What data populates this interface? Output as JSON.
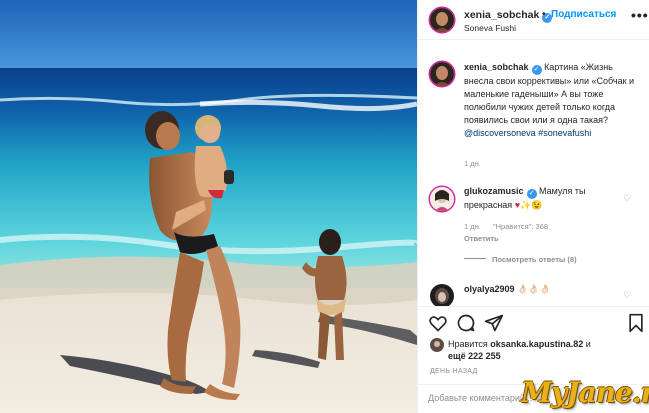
{
  "post": {
    "image_alt": "Beach photo: woman holding a child, another child standing in the surf",
    "author": "xenia_sobchak",
    "follow_separator": "•",
    "follow_label": "Подписаться",
    "location": "Soneva Fushi",
    "more_label": "•••"
  },
  "caption": {
    "author": "xenia_sobchak",
    "text": "Картина «Жизнь внесла свои коррективы» или «Собчак и маленькие гаденыши» А вы тоже полюбили чужих детей только когда появились свои или я одна такая?",
    "mention": "@discoversoneva",
    "hashtag": "#sonevafushi",
    "time": "1 дн."
  },
  "comments": [
    {
      "author": "glukozamusic",
      "text": "Мамуля ты прекрасная",
      "emoji": "♥︎✨😉",
      "time": "1 дн.",
      "likes": "\"Нравится\": 368",
      "reply_label": "Ответить",
      "view_replies": "Посмотреть ответы (8)"
    },
    {
      "author": "olyalya2909",
      "text": "👌🏻👌🏻👌🏻"
    }
  ],
  "likes": {
    "prefix": "Нравится",
    "user": "oksanka.kapustina.82",
    "and": "и",
    "others": "ещё 222 255"
  },
  "date": "ДЕНЬ НАЗАД",
  "add_comment": {
    "placeholder": "Добавьте комментарий..."
  },
  "watermark": "MyJane.ru",
  "icons": [
    "heart-icon",
    "comment-icon",
    "share-icon",
    "bookmark-icon",
    "verified-icon"
  ],
  "colors": {
    "link_blue": "#0095f6",
    "verified": "#3897f0",
    "sea": "#2fbfd1",
    "sand": "#efe6d6",
    "sky": "#2a78c8"
  }
}
